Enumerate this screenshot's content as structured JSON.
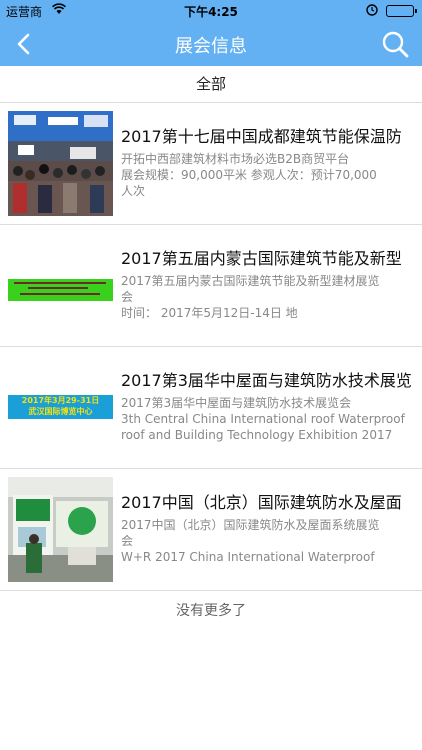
{
  "status": {
    "carrier": "运营商",
    "time": "下午4:25"
  },
  "nav": {
    "title": "展会信息"
  },
  "filter": {
    "label": "全部"
  },
  "items": [
    {
      "title": "2017第十七届中国成都建筑节能保温防",
      "desc_line1": "开拓中西部建筑材料市场必选B2B商贸平台",
      "desc_line2": "展会规模：90,000平米    参观人次：预计70,000",
      "desc_line3": "人次"
    },
    {
      "title": "2017第五届内蒙古国际建筑节能及新型",
      "desc_line1": "2017第五届内蒙古国际建筑节能及新型建材展览",
      "desc_line2": "会",
      "desc_line3": " 时间：  2017年5月12日-14日                    地"
    },
    {
      "title": "2017第3届华中屋面与建筑防水技术展览",
      "desc_line1": "2017第3届华中屋面与建筑防水技术展览会",
      "desc_line2": "3th Central China International roof Waterproof",
      "desc_line3": "roof and Building Technology Exhibition 2017",
      "banner_text_1": "2017年3月29-31日",
      "banner_text_2": "武汉国际博览中心"
    },
    {
      "title": "2017中国（北京）国际建筑防水及屋面",
      "desc_line1": "2017中国（北京）国际建筑防水及屋面系统展览",
      "desc_line2": "会",
      "desc_line3": "W+R 2017 China International Waterproof"
    }
  ],
  "footer": {
    "text": "没有更多了"
  }
}
